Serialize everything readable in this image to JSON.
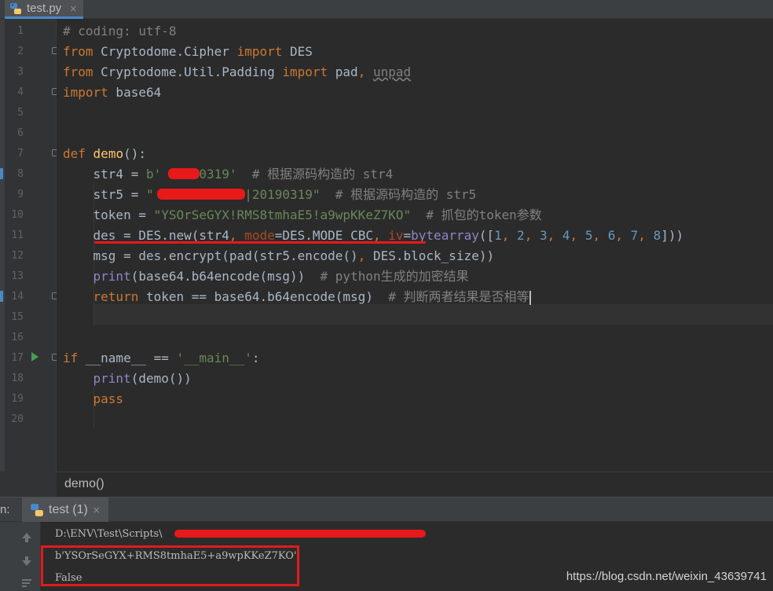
{
  "tab": {
    "label": "test.py",
    "close": "×",
    "icon": "python-file-icon"
  },
  "editor": {
    "line_numbers": [
      "1",
      "2",
      "3",
      "4",
      "5",
      "6",
      "7",
      "8",
      "9",
      "10",
      "11",
      "12",
      "13",
      "14",
      "15",
      "16",
      "17",
      "18",
      "19",
      "20"
    ],
    "lines": [
      {
        "n": 1,
        "parts": [
          [
            "cmt",
            "# coding: utf-8"
          ]
        ]
      },
      {
        "n": 2,
        "parts": [
          [
            "kw",
            "from"
          ],
          [
            "plain",
            " Cryptodome.Cipher "
          ],
          [
            "kw",
            "import"
          ],
          [
            "plain",
            " DES"
          ]
        ]
      },
      {
        "n": 3,
        "parts": [
          [
            "kw",
            "from"
          ],
          [
            "plain",
            " Cryptodome.Util.Padding "
          ],
          [
            "kw",
            "import"
          ],
          [
            "plain",
            " pad"
          ],
          [
            "kw",
            ","
          ],
          [
            "plain",
            " "
          ],
          [
            "unused",
            "unpad"
          ]
        ]
      },
      {
        "n": 4,
        "parts": [
          [
            "kw",
            "import"
          ],
          [
            "plain",
            " base64"
          ]
        ]
      },
      {
        "n": 7,
        "parts": [
          [
            "kw",
            "def"
          ],
          [
            "plain",
            " "
          ],
          [
            "fn",
            "demo"
          ],
          [
            "plain",
            "():"
          ]
        ]
      },
      {
        "n": 8,
        "parts": [
          [
            "plain",
            "    str4 = "
          ],
          [
            "str",
            "b'"
          ],
          [
            "str",
            "     "
          ],
          [
            "str",
            "0319'"
          ],
          [
            "plain",
            "  "
          ],
          [
            "cmt",
            "# 根据源码构造的 str4"
          ]
        ]
      },
      {
        "n": 9,
        "parts": [
          [
            "plain",
            "    str5 = "
          ],
          [
            "str",
            "\""
          ],
          [
            "str",
            "            "
          ],
          [
            "str",
            "|20190319\""
          ],
          [
            "plain",
            "  "
          ],
          [
            "cmt",
            "# 根据源码构造的 str5"
          ]
        ]
      },
      {
        "n": 10,
        "parts": [
          [
            "plain",
            "    token = "
          ],
          [
            "str",
            "\"YSOrSeGYX!RMS8tmhaE5!a9wpKKeZ7KO\""
          ],
          [
            "plain",
            "  "
          ],
          [
            "cmt",
            "# 抓包的token参数"
          ]
        ]
      },
      {
        "n": 11,
        "parts": [
          [
            "plain",
            "    des = DES.new(str4"
          ],
          [
            "kw",
            ","
          ],
          [
            "plain",
            " "
          ],
          [
            "param",
            "mode"
          ],
          [
            "plain",
            "=DES.MODE_CBC"
          ],
          [
            "kw",
            ","
          ],
          [
            "plain",
            " "
          ],
          [
            "param",
            "iv"
          ],
          [
            "plain",
            "="
          ],
          [
            "builtin",
            "bytearray"
          ],
          [
            "plain",
            "(["
          ],
          [
            "num",
            "1"
          ],
          [
            "kw",
            ","
          ],
          [
            "plain",
            " "
          ],
          [
            "num",
            "2"
          ],
          [
            "kw",
            ","
          ],
          [
            "plain",
            " "
          ],
          [
            "num",
            "3"
          ],
          [
            "kw",
            ","
          ],
          [
            "plain",
            " "
          ],
          [
            "num",
            "4"
          ],
          [
            "kw",
            ","
          ],
          [
            "plain",
            " "
          ],
          [
            "num",
            "5"
          ],
          [
            "kw",
            ","
          ],
          [
            "plain",
            " "
          ],
          [
            "num",
            "6"
          ],
          [
            "kw",
            ","
          ],
          [
            "plain",
            " "
          ],
          [
            "num",
            "7"
          ],
          [
            "kw",
            ","
          ],
          [
            "plain",
            " "
          ],
          [
            "num",
            "8"
          ],
          [
            "plain",
            "]))"
          ]
        ]
      },
      {
        "n": 12,
        "parts": [
          [
            "plain",
            "    msg = des.encrypt(pad(str5.encode()"
          ],
          [
            "kw",
            ","
          ],
          [
            "plain",
            " DES.block_size))"
          ]
        ]
      },
      {
        "n": 13,
        "parts": [
          [
            "plain",
            "    "
          ],
          [
            "builtin",
            "print"
          ],
          [
            "plain",
            "(base64.b64encode(msg))  "
          ],
          [
            "cmt",
            "# python生成的加密结果"
          ]
        ]
      },
      {
        "n": 14,
        "parts": [
          [
            "plain",
            "    "
          ],
          [
            "kw",
            "return"
          ],
          [
            "plain",
            " token == base64.b64encode(msg)  "
          ],
          [
            "cmt",
            "# 判断两者结果是否相等"
          ]
        ]
      },
      {
        "n": 17,
        "parts": [
          [
            "kw",
            "if"
          ],
          [
            "plain",
            " __name__ == "
          ],
          [
            "str",
            "'__main__'"
          ],
          [
            "plain",
            ":"
          ]
        ]
      },
      {
        "n": 18,
        "parts": [
          [
            "plain",
            "    "
          ],
          [
            "builtin",
            "print"
          ],
          [
            "plain",
            "(demo())"
          ]
        ]
      },
      {
        "n": 19,
        "parts": [
          [
            "plain",
            "    "
          ],
          [
            "kw",
            "pass"
          ]
        ]
      }
    ]
  },
  "breadcrumb": {
    "label": "demo()"
  },
  "run": {
    "prefix": "n:",
    "tab_label": "test (1)",
    "tab_close": "×",
    "console": {
      "command": "D:\\ENV\\Test\\Scripts\\",
      "output_bytes": "b'YSOrSeGYX+RMS8tmhaE5+a9wpKKeZ7KO'",
      "output_bool": "False"
    }
  },
  "watermark": "https://blog.csdn.net/weixin_43639741",
  "colors": {
    "keyword": "#cc7832",
    "string": "#6a8759",
    "comment": "#808080",
    "number": "#6897bb",
    "function": "#ffc66d",
    "annotation_red": "#e8191a"
  }
}
